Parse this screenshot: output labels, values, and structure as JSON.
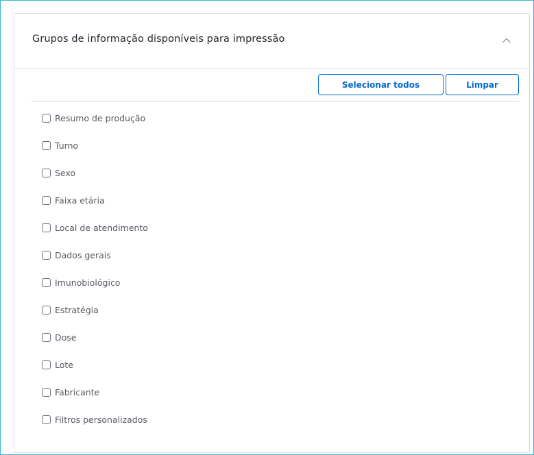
{
  "panel": {
    "title": "Grupos de informação disponíveis para impressão",
    "collapse_icon": "chevron-up-icon"
  },
  "toolbar": {
    "select_all_label": "Selecionar todos",
    "clear_label": "Limpar"
  },
  "options": [
    {
      "label": "Resumo de produção",
      "checked": false
    },
    {
      "label": "Turno",
      "checked": false
    },
    {
      "label": "Sexo",
      "checked": false
    },
    {
      "label": "Faixa etária",
      "checked": false
    },
    {
      "label": "Local de atendimento",
      "checked": false
    },
    {
      "label": "Dados gerais",
      "checked": false
    },
    {
      "label": "Imunobiológico",
      "checked": false
    },
    {
      "label": "Estratégia",
      "checked": false
    },
    {
      "label": "Dose",
      "checked": false
    },
    {
      "label": "Lote",
      "checked": false
    },
    {
      "label": "Fabricante",
      "checked": false
    },
    {
      "label": "Filtros personalizados",
      "checked": false
    }
  ],
  "colors": {
    "accent": "#0069d0",
    "frame_border": "#38b6cc",
    "divider": "#d9dcdf",
    "title_text": "#24252e",
    "label_text": "#555861"
  }
}
